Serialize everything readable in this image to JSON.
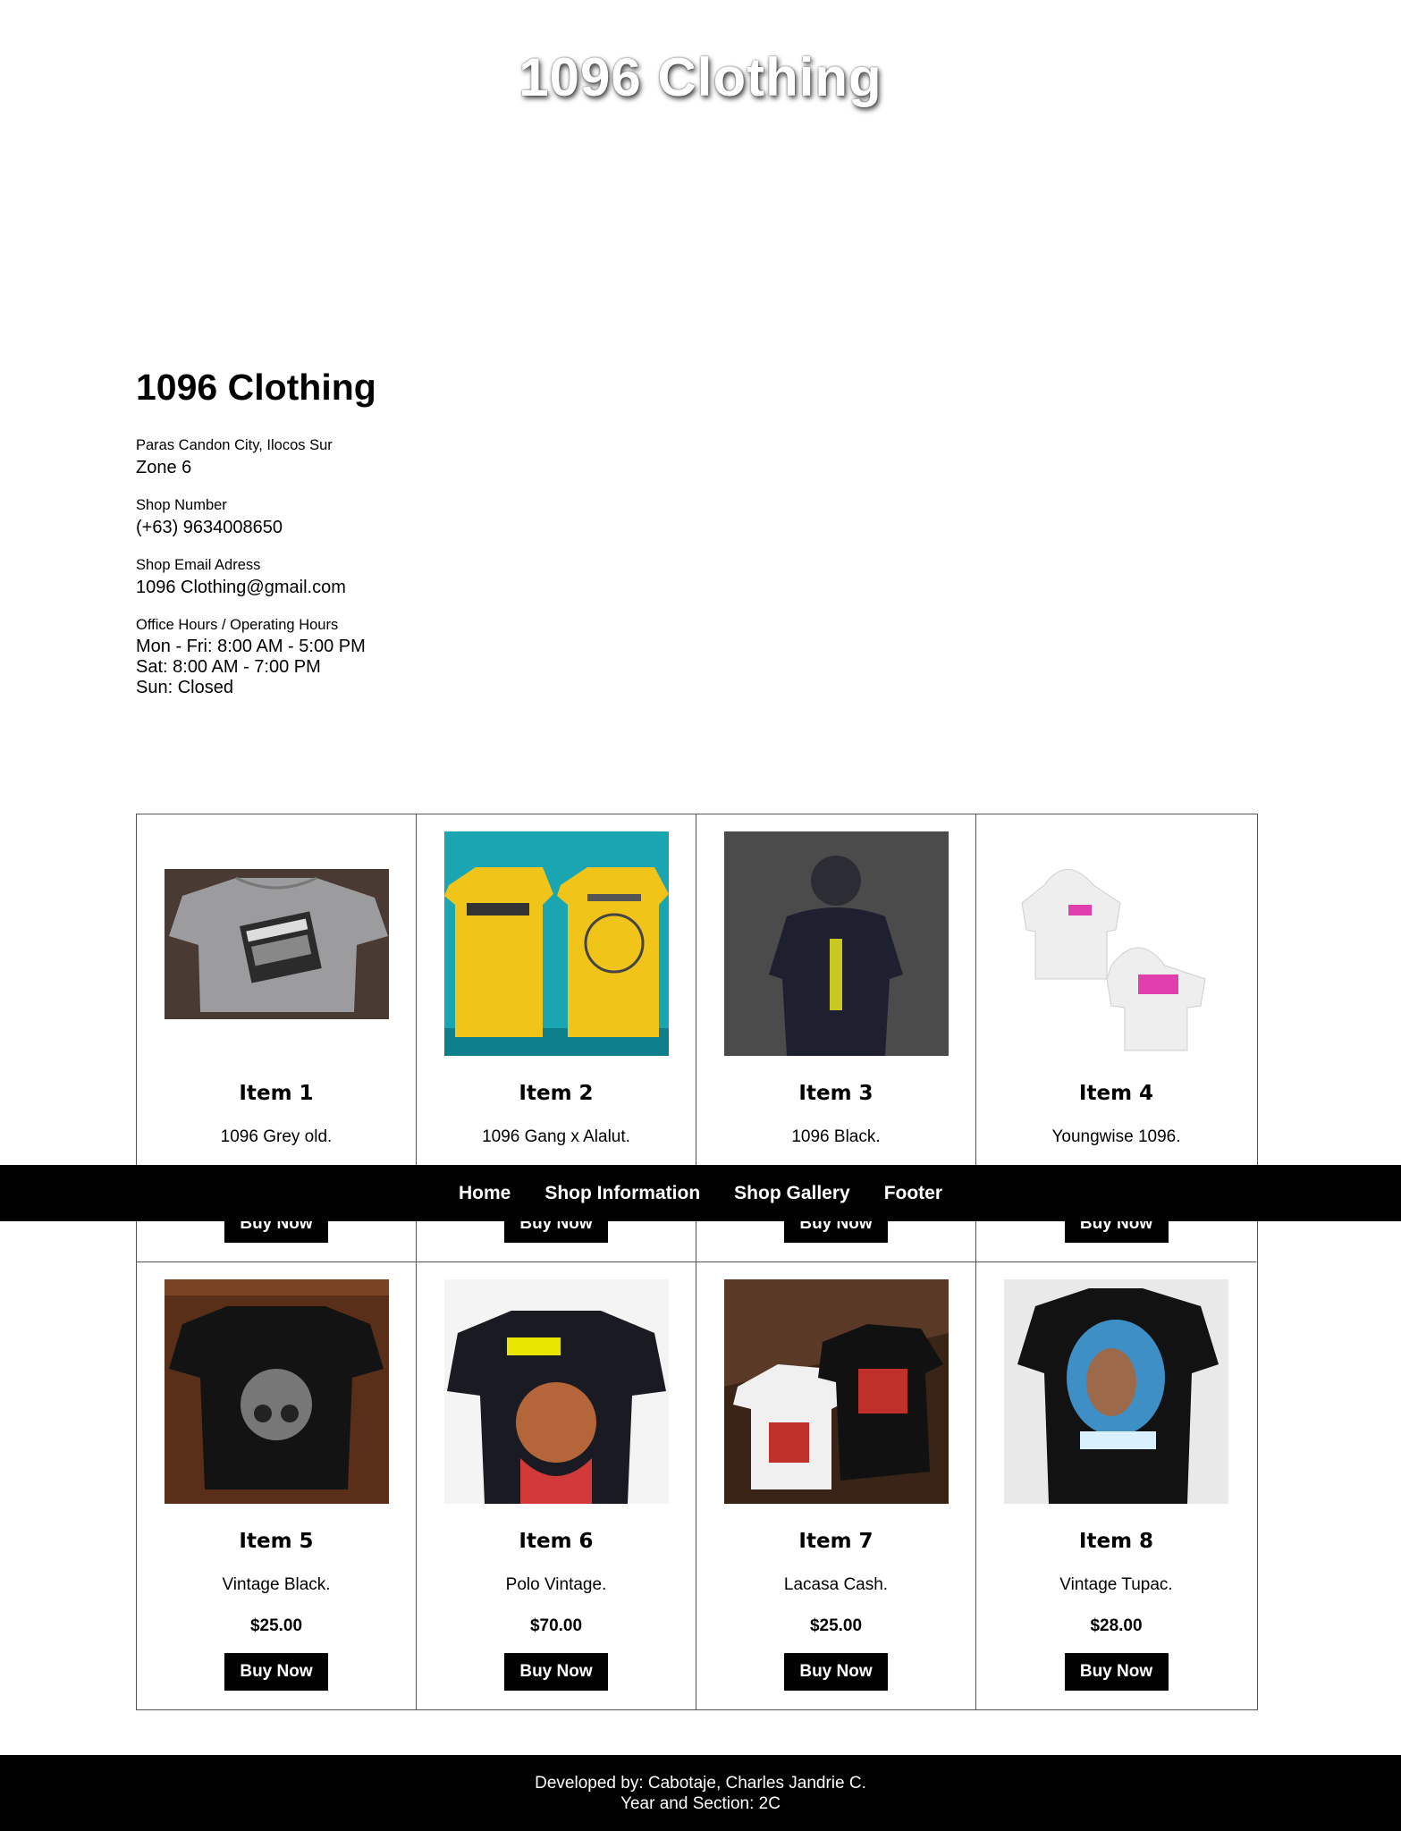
{
  "header": {
    "title": "1096 Clothing"
  },
  "shop": {
    "name": "1096 Clothing",
    "address_label": "Paras Candon City, Ilocos Sur",
    "address_value": "Zone 6",
    "number_label": "Shop Number",
    "number_value": "(+63) 9634008650",
    "email_label": "Shop Email Adress",
    "email_value": "1096 Clothing@gmail.com",
    "hours_label": "Office Hours / Operating Hours",
    "hours": [
      "Mon - Fri: 8:00 AM - 5:00 PM",
      "Sat: 8:00 AM - 7:00 PM",
      "Sun: Closed"
    ]
  },
  "nav": {
    "items": [
      "Home",
      "Shop Information",
      "Shop Gallery",
      "Footer"
    ]
  },
  "gallery": {
    "buy_label": "Buy Now",
    "items": [
      {
        "name": "Item 1",
        "desc": "1096 Grey old.",
        "price": ""
      },
      {
        "name": "Item 2",
        "desc": "1096 Gang x Alalut.",
        "price": ""
      },
      {
        "name": "Item 3",
        "desc": "1096 Black.",
        "price": ""
      },
      {
        "name": "Item 4",
        "desc": "Youngwise 1096.",
        "price": ""
      },
      {
        "name": "Item 5",
        "desc": "Vintage Black.",
        "price": "$25.00"
      },
      {
        "name": "Item 6",
        "desc": "Polo Vintage.",
        "price": "$70.00"
      },
      {
        "name": "Item 7",
        "desc": "Lacasa Cash.",
        "price": "$25.00"
      },
      {
        "name": "Item 8",
        "desc": "Vintage Tupac.",
        "price": "$28.00"
      }
    ]
  },
  "footer": {
    "line1": "Developed by: Cabotaje, Charles Jandrie C.",
    "line2": "Year and Section: 2C"
  },
  "colors": {
    "nav_bg": "#000000",
    "button_bg": "#000000",
    "page_bg": "#ffffff"
  }
}
